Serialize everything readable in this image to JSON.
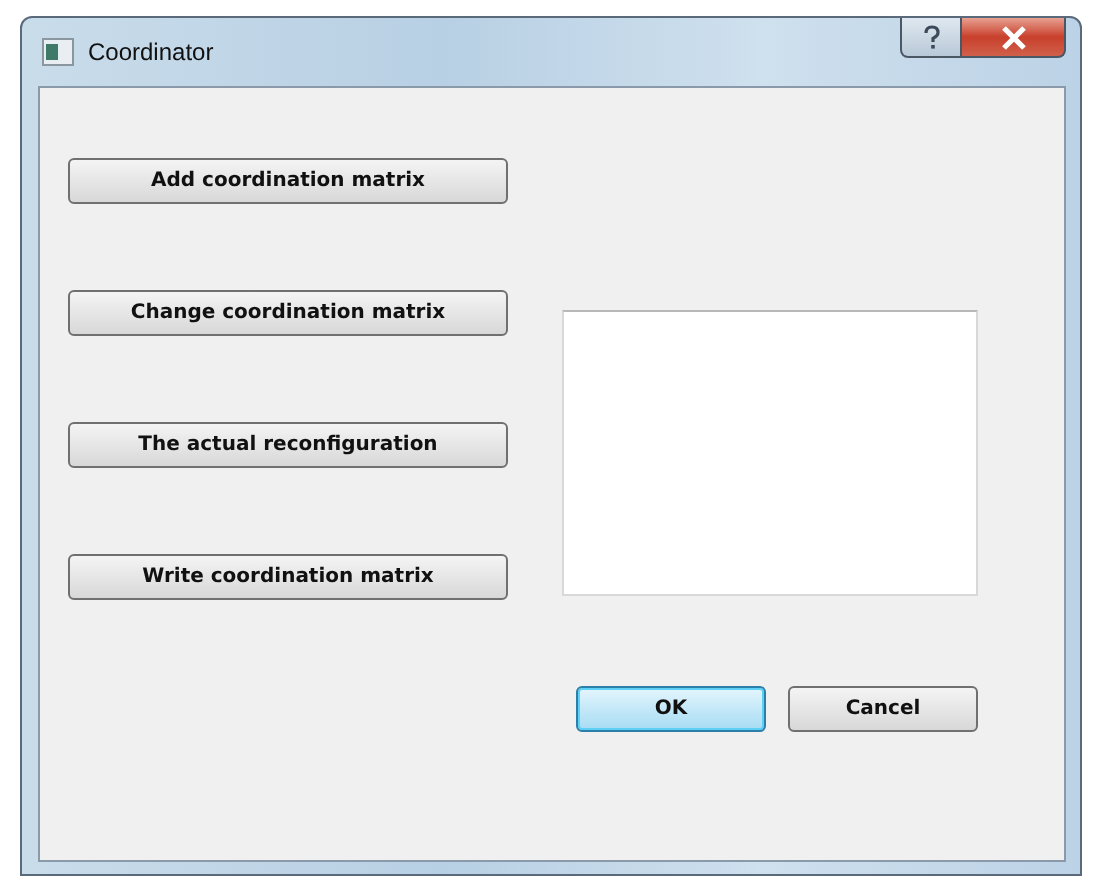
{
  "window": {
    "title": "Coordinator"
  },
  "actions": [
    {
      "label": "Add coordination matrix"
    },
    {
      "label": "Change coordination matrix"
    },
    {
      "label": "The actual reconfiguration"
    },
    {
      "label": "Write coordination matrix"
    }
  ],
  "dialog_buttons": [
    {
      "label": "OK",
      "default": true
    },
    {
      "label": "Cancel",
      "default": false
    }
  ]
}
